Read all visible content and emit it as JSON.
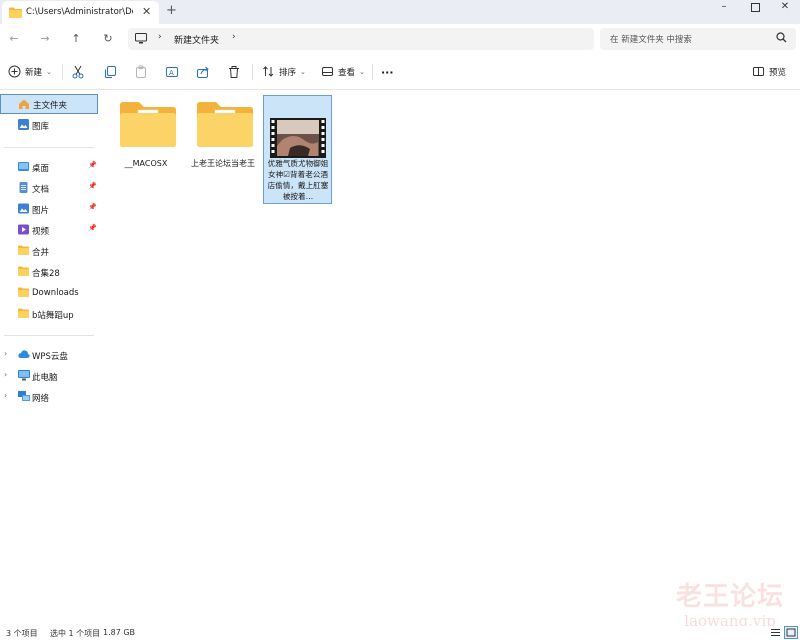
{
  "window": {
    "tab_title": "C:\\Users\\Administrator\\Desktop",
    "tab_close_icon": "close-icon",
    "new_tab_icon": "plus-icon",
    "minimize_icon": "minimize-icon",
    "maximize_icon": "maximize-icon",
    "close_icon": "close-icon"
  },
  "nav": {
    "back_icon": "arrow-left-icon",
    "forward_icon": "arrow-right-icon",
    "up_icon": "arrow-up-icon",
    "refresh_icon": "refresh-icon",
    "address_crumbs": [
      "新建文件夹"
    ],
    "search_placeholder": "在 新建文件夹 中搜索"
  },
  "toolbar": {
    "new_label": "新建",
    "sort_label": "排序",
    "view_label": "查看",
    "more_label": "···",
    "preview_label": "预览",
    "icons": [
      "cut-icon",
      "copy-icon",
      "paste-icon",
      "rename-icon",
      "share-icon",
      "delete-icon"
    ]
  },
  "sidebar": {
    "home_label": "主文件夹",
    "gallery_label": "图库",
    "quick_access": [
      {
        "label": "桌面",
        "icon": "desktop-icon",
        "pinned": true
      },
      {
        "label": "文档",
        "icon": "documents-icon",
        "pinned": true
      },
      {
        "label": "图片",
        "icon": "pictures-icon",
        "pinned": true
      },
      {
        "label": "视频",
        "icon": "videos-icon",
        "pinned": true
      },
      {
        "label": "合并",
        "icon": "folder-icon",
        "pinned": false
      },
      {
        "label": "合集28",
        "icon": "folder-icon",
        "pinned": false
      },
      {
        "label": "Downloads",
        "icon": "folder-icon",
        "pinned": false
      },
      {
        "label": "b站舞蹈up",
        "icon": "folder-icon",
        "pinned": false
      }
    ],
    "locations": [
      {
        "label": "WPS云盘",
        "icon": "cloud-icon"
      },
      {
        "label": "此电脑",
        "icon": "computer-icon"
      },
      {
        "label": "网络",
        "icon": "network-icon"
      }
    ]
  },
  "files": [
    {
      "name": "__MACOSX",
      "type": "folder",
      "selected": false
    },
    {
      "name": "上老王论坛当老王",
      "type": "folder",
      "selected": false
    },
    {
      "name": "优雅气质尤物御姐女神☑背着老公酒店偷情，戴上肛塞被按着…",
      "type": "video",
      "selected": true
    }
  ],
  "status": {
    "count": "3 个项目",
    "selection": "选中 1 个项目",
    "size": "1.87 GB"
  },
  "watermark": {
    "line1": "老王论坛",
    "line2": "laowang.vip"
  },
  "colors": {
    "accent": "#0067c0",
    "selection_bg": "#cce4f7",
    "selection_border": "#6b9fd4",
    "folder_yellow": "#f8c94a",
    "titlebar_bg": "#eaeef4",
    "close_red": "#e81123"
  }
}
